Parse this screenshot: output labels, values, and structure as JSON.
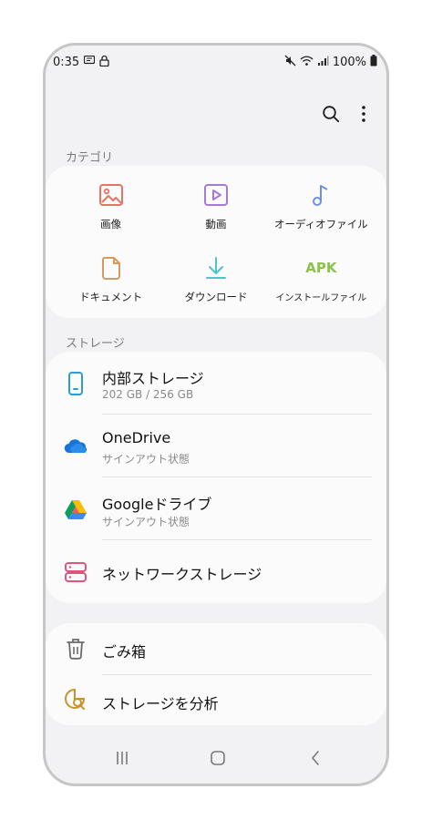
{
  "status_bar": {
    "time": "0:35",
    "battery": "100%",
    "left_icons": [
      "message-icon",
      "lock-icon"
    ],
    "right_icons": [
      "mute-icon",
      "wifi-icon",
      "signal-icon",
      "battery-icon"
    ]
  },
  "toolbar": {
    "icons": [
      "search-icon",
      "more-options-icon"
    ]
  },
  "categories": {
    "title": "カテゴリ",
    "items": [
      {
        "label": "画像",
        "icon": "image-icon",
        "color": "#e57366"
      },
      {
        "label": "動画",
        "icon": "video-icon",
        "color": "#a678d8"
      },
      {
        "label": "オーディオファイル",
        "icon": "music-note-icon",
        "color": "#6d8fe8"
      },
      {
        "label": "ドキュメント",
        "icon": "document-icon",
        "color": "#d49a5f"
      },
      {
        "label": "ダウンロード",
        "icon": "download-icon",
        "color": "#4cc4c9"
      },
      {
        "label": "インストールファイル",
        "icon": "apk-icon",
        "icon_text": "APK",
        "color": "#8bc34a"
      }
    ]
  },
  "storage": {
    "title": "ストレージ",
    "items": [
      {
        "title": "内部ストレージ",
        "subtitle": "202 GB / 256 GB",
        "icon": "phone-storage-icon"
      },
      {
        "title": "OneDrive",
        "subtitle": "サインアウト状態",
        "icon": "onedrive-icon"
      },
      {
        "title": "Googleドライブ",
        "subtitle": "サインアウト状態",
        "icon": "google-drive-icon"
      },
      {
        "title": "ネットワークストレージ",
        "subtitle": "",
        "icon": "network-storage-icon"
      }
    ]
  },
  "tools": {
    "items": [
      {
        "title": "ごみ箱",
        "icon": "trash-icon"
      },
      {
        "title": "ストレージを分析",
        "icon": "storage-analysis-icon"
      }
    ]
  },
  "nav_bar": {
    "icons": [
      "recent-apps-icon",
      "home-icon",
      "back-icon"
    ]
  },
  "colors": {
    "background": "#f2f2f4",
    "card": "#fbfbfb",
    "secondary_text": "#8a8a8a"
  }
}
